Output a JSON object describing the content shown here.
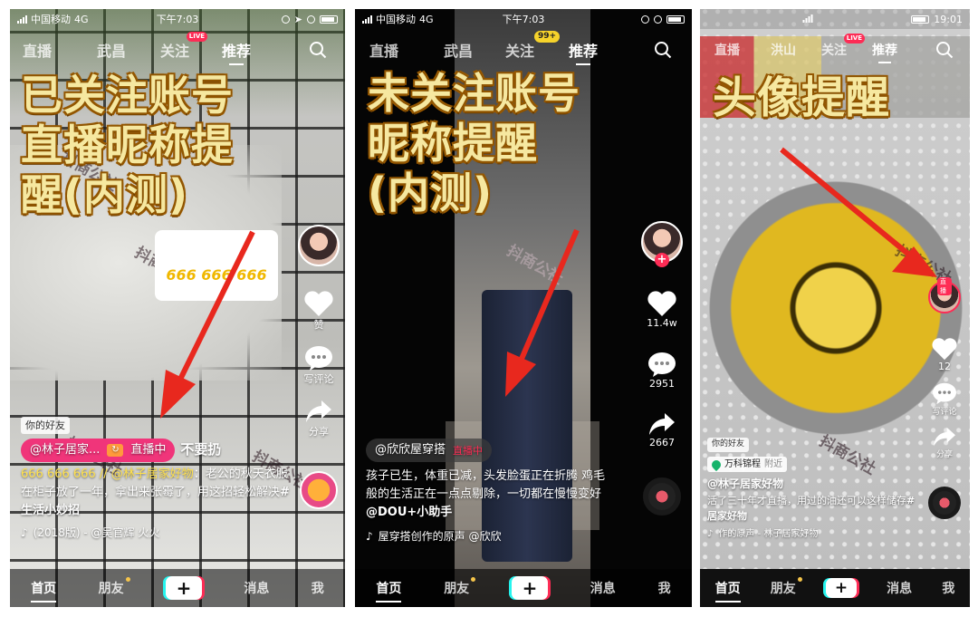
{
  "panels": [
    {
      "status": {
        "carrier": "中国移动",
        "network": "4G",
        "time": "下午7:03"
      },
      "nav": {
        "home": "直播",
        "local": "武昌",
        "following": "关注",
        "live_badge": "LIVE",
        "recommend": "推荐"
      },
      "headline": [
        "已关注账号",
        "直播昵称提",
        "醒(内测)"
      ],
      "sticker_text": "666 666 666",
      "friend_tag": "你的好友",
      "live_name": "@林子居家...",
      "live_status": "直播中",
      "overlay_text": "不要扔",
      "caption_prefix": "666 666 666 // @林子居家好物",
      "caption_body": "：老公的秋天衣服在柜子放了一年，拿出来张霉了，用这招轻松解决",
      "caption_tag": "#生活小妙招",
      "music": "(2018版) - @吴官辉   火火",
      "like_label": "赞",
      "comment_label": "写评论",
      "share_label": "分享",
      "watermark": "抖商公社",
      "tabs": {
        "home": "首页",
        "friends": "朋友",
        "plus": "+",
        "messages": "消息",
        "me": "我"
      }
    },
    {
      "status": {
        "carrier": "中国移动",
        "network": "4G",
        "time": "下午7:03"
      },
      "nav": {
        "home": "直播",
        "local": "武昌",
        "following": "关注",
        "count_badge": "99+",
        "recommend": "推荐"
      },
      "headline": [
        "未关注账号",
        "昵称提醒",
        "(内测)"
      ],
      "name_pill": "@欣欣屋穿搭",
      "name_pill_status": "直播中",
      "caption": "孩子已生，体重已减，头发脸蛋正在折腾 鸡毛般的生活正在一点点剔除，一切都在慢慢变好",
      "caption_tag": "@DOU+小助手",
      "music": "屋穿搭创作的原声   @欣欣",
      "likes": "11.4w",
      "comments": "2951",
      "shares": "2667",
      "watermark": "抖商公社",
      "tabs": {
        "home": "首页",
        "friends": "朋友",
        "plus": "+",
        "messages": "消息",
        "me": "我"
      }
    },
    {
      "status": {
        "time": "19:01"
      },
      "nav": {
        "home": "直播",
        "local": "洪山",
        "following": "关注",
        "live_badge": "LIVE",
        "recommend": "推荐"
      },
      "headline": [
        "头像提醒"
      ],
      "avatar_live_label": "直播",
      "friend_tag": "你的好友",
      "location": "万科锦程",
      "location_suffix": "附近",
      "username": "@林子居家好物",
      "caption": "活了三十年才直播，用过的油还可以这样储存",
      "caption_tag": "#居家好物",
      "music": "作的原声 - 林子居家好物",
      "likes": "12",
      "comment_label": "写评论",
      "share_label": "分享",
      "watermark": "抖商公社",
      "tabs": {
        "home": "首页",
        "friends": "朋友",
        "plus": "+",
        "messages": "消息",
        "me": "我"
      }
    }
  ],
  "colors": {
    "accent_red": "#fe2c55",
    "live_pink": "#f0357a",
    "headline_yellow": "#f6e8a0",
    "arrow_red": "#e8281e"
  }
}
